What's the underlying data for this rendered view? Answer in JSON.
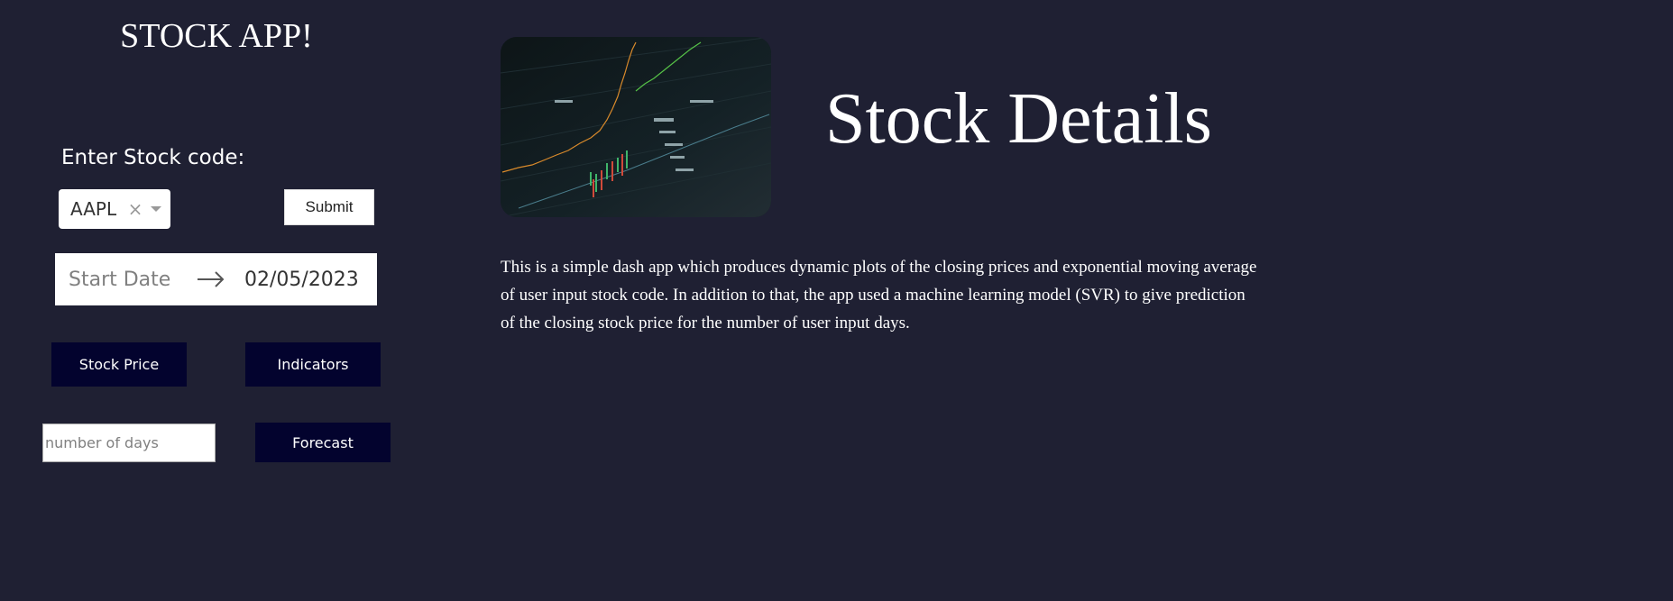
{
  "sidebar": {
    "title": "STOCK APP!",
    "stock_label": "Enter Stock code:",
    "stock_select": {
      "value": "AAPL",
      "clear_symbol": "×"
    },
    "submit_label": "Submit",
    "date_range": {
      "start_placeholder": "Start Date",
      "end_value": "02/05/2023"
    },
    "stock_price_label": "Stock Price",
    "indicators_label": "Indicators",
    "days_placeholder": "number of days",
    "forecast_label": "Forecast"
  },
  "main": {
    "title": "Stock Details",
    "description": "This is a simple dash app which produces dynamic plots of the closing prices and exponential moving average of user input stock code. In addition to that, the app used a machine learning model (SVR) to give prediction of the closing stock price for the number of user input days."
  },
  "colors": {
    "background": "#1f2033",
    "button_dark": "#03032e",
    "text": "#ffffff"
  }
}
